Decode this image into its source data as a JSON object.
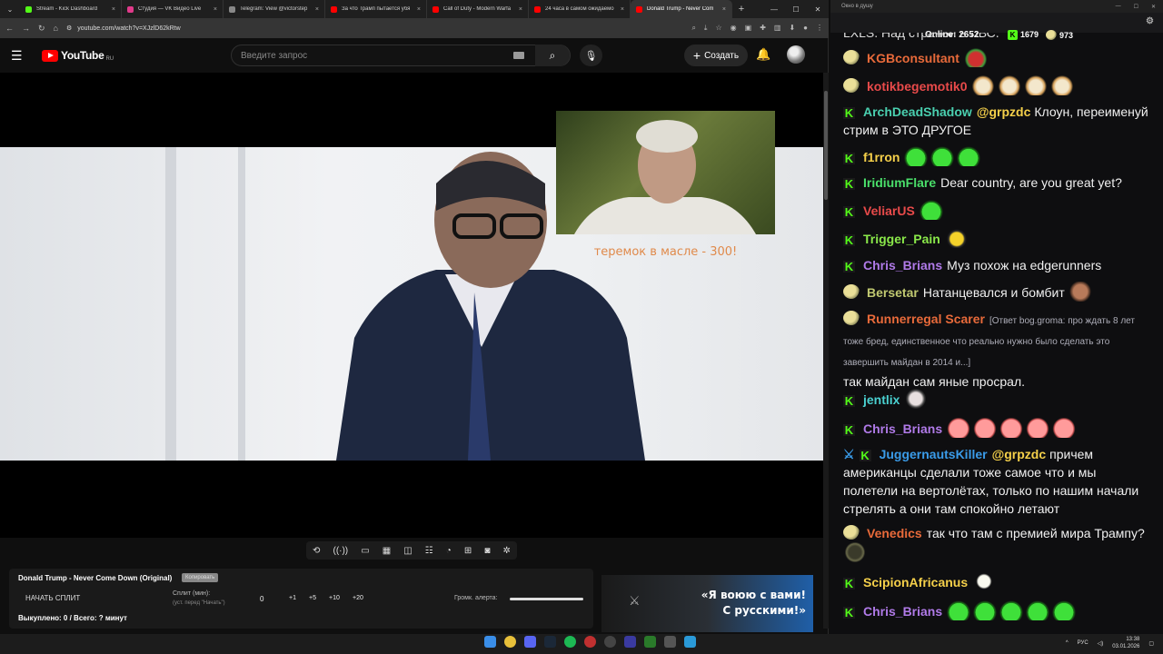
{
  "browser": {
    "tabs": [
      {
        "title": "Stream - Kick Dashboard",
        "color": "#53fc18"
      },
      {
        "title": "Студия — VK Видео Live",
        "color": "#e03a8a"
      },
      {
        "title": "Telegram: View @victorstep",
        "color": "#888888"
      },
      {
        "title": "За что Трамп пытается убя",
        "color": "#ff0000"
      },
      {
        "title": "Call of Duty - Modern Warfa",
        "color": "#ff0000"
      },
      {
        "title": "24 часа в самом ожидаемо",
        "color": "#ff0000"
      },
      {
        "title": "Donald Trump - Never Com",
        "color": "#ff0000"
      }
    ],
    "url": "youtube.com/watch?v=XJzlD62kRtw"
  },
  "youtube": {
    "logo_text": "YouTube",
    "region": "RU",
    "search_placeholder": "Введите запрос",
    "create_label": "Создать"
  },
  "video": {
    "webcam_caption": "теремок в масле - 300!"
  },
  "panel": {
    "title": "Donald Trump - Never Come Down (Original)",
    "tag": "Копировать",
    "start_label": "НАЧАТЬ СПЛИТ",
    "split_label": "Сплит (мин):",
    "split_hint": "(уст. перед \"Начать\")",
    "split_value": "0",
    "increments": [
      "+1",
      "+5",
      "+10",
      "+20"
    ],
    "alert_label": "Громк. алерта:",
    "bought": "Выкуплено: 0 / Всего: ? минут",
    "alert_volume_fraction": 1.0
  },
  "ad": {
    "line1": "«Я воюю с вами!",
    "line2": "С русскими!»"
  },
  "chat": {
    "window_title": "Окно в душу",
    "online_label": "Online:",
    "online_count": "2652",
    "kick_count": "1679",
    "pepe_count": "973",
    "top_clip_text": "LXLS. Над странои в ЛВС.",
    "messages": [
      {
        "user": "KGBconsultant",
        "color": "#e86a3a",
        "badge": "pepe",
        "text": ""
      },
      {
        "user": "kotikbegemotik0",
        "color": "#e84a4a",
        "badge": "pepe",
        "text": ""
      },
      {
        "user": "ArchDeadShadow",
        "color": "#4ad0b0",
        "badge": "kick",
        "mention": "@grpzdc",
        "text": "Клоун, переименуй стрим в ЭТО ДРУГОЕ"
      },
      {
        "user": "f1rron",
        "color": "#f5d04a",
        "badge": "kick",
        "text": ""
      },
      {
        "user": "IridiumFlare",
        "color": "#4adf6a",
        "badge": "kick",
        "text": "Dear country, are you great yet?"
      },
      {
        "user": "VeliarUS",
        "color": "#e84a4a",
        "badge": "kick",
        "text": ""
      },
      {
        "user": "Trigger_Pain",
        "color": "#8ae84a",
        "badge": "kick",
        "text": ""
      },
      {
        "user": "Chris_Brians",
        "color": "#b07ae8",
        "badge": "kick",
        "text": "Муз похож на edgerunners"
      },
      {
        "user": "Bersetar",
        "color": "#c0c870",
        "badge": "pepe",
        "text": "Натанцевался и бомбит"
      },
      {
        "user": "Runnerregal Scarer",
        "color": "#e86a3a",
        "badge": "pepe",
        "reply": "[Ответ bog.groma: про ждать 8 лет тоже бред, единственное что реально нужно было сделать это завершить майдан в 2014 и...]",
        "text": "так майдан сам яные просрал."
      },
      {
        "user": "jentlix",
        "color": "#4ad0d0",
        "badge": "kick",
        "text": ""
      },
      {
        "user": "Chris_Brians",
        "color": "#b07ae8",
        "badge": "kick",
        "text": ""
      },
      {
        "user": "JuggernautsKiller",
        "color": "#3a9be8",
        "badge": "kick",
        "mention": "@grpzdc",
        "text": "причем американцы сделали тоже самое что и мы полетели на вертолётах, только по нашим начали стрелять а они там спокойно летают"
      },
      {
        "user": "Venedics",
        "color": "#e86a3a",
        "badge": "pepe",
        "text": "так что там с премией мира Трампу?"
      },
      {
        "user": "ScipionAfricanus",
        "color": "#f5d04a",
        "badge": "kick",
        "text": ""
      },
      {
        "user": "Chris_Brians",
        "color": "#b07ae8",
        "badge": "kick",
        "text": ""
      }
    ]
  },
  "taskbar": {
    "lang": "РУС",
    "time": "13:38",
    "date": "03.01.2026"
  }
}
